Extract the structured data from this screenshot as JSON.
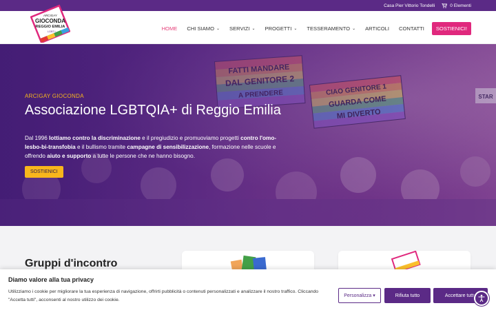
{
  "topbar": {
    "location": "Casa Pier Vittorio Tondelli",
    "cart": "0 Elementi"
  },
  "logo": {
    "line1": "ARCIGAY",
    "line2": "GIOCONDA",
    "line3": "REGGIO EMILIA",
    "line4": "LGBT+"
  },
  "nav": {
    "items": [
      {
        "label": "HOME",
        "active": true,
        "dropdown": false
      },
      {
        "label": "CHI SIAMO",
        "active": false,
        "dropdown": true
      },
      {
        "label": "SERVIZI",
        "active": false,
        "dropdown": true
      },
      {
        "label": "PROGETTI",
        "active": false,
        "dropdown": true
      },
      {
        "label": "TESSERAMENTO",
        "active": false,
        "dropdown": true
      },
      {
        "label": "ARTICOLI",
        "active": false,
        "dropdown": false
      },
      {
        "label": "CONTATTI",
        "active": false,
        "dropdown": false
      }
    ],
    "cta": "SOSTIENICI!"
  },
  "hero": {
    "eyebrow": "ARCIGAY GIOCONDA",
    "title": "Associazione LGBTQIA+ di Reggio Emilia",
    "desc_parts": [
      {
        "t": "Dal 1996 ",
        "b": false
      },
      {
        "t": "lottiamo contro la discriminazione",
        "b": true
      },
      {
        "t": " e il pregiudizio e promuoviamo progetti ",
        "b": false
      },
      {
        "t": "contro l'omo-lesbo-bi-transfobia",
        "b": true
      },
      {
        "t": " e il bullismo tramite ",
        "b": false
      },
      {
        "t": "campagne di sensibilizzazione",
        "b": true
      },
      {
        "t": ", formazione nelle scuole e offrendo ",
        "b": false
      },
      {
        "t": "aiuto e supporto",
        "b": true
      },
      {
        "t": " a tutte le persone che ne hanno bisogno.",
        "b": false
      }
    ],
    "button": "SOSTIENICI",
    "signs": [
      "FATTI MANDARE DAL GENITORE 2 A PRENDERE",
      "CIAO GENITORE 1 GUARDA COME MI DIVERTO",
      "STAR"
    ]
  },
  "section": {
    "title": "Gruppi d'incontro"
  },
  "cookie": {
    "title": "Diamo valore alla tua privacy",
    "text": "Utilizziamo i cookie per migliorare la tua esperienza di navigazione, offrirti pubblicità o contenuti personalizzati e analizzare il nostro traffico. Cliccando \"Accetta tutti\", acconsenti al nostro utilizzo dei cookie.",
    "customize": "Personalizza",
    "reject": "Rifiuta tutto",
    "accept": "Accettare tutto"
  },
  "colors": {
    "purple": "#5b2a86",
    "pink": "#e0287d",
    "yellow": "#f8b61c"
  }
}
